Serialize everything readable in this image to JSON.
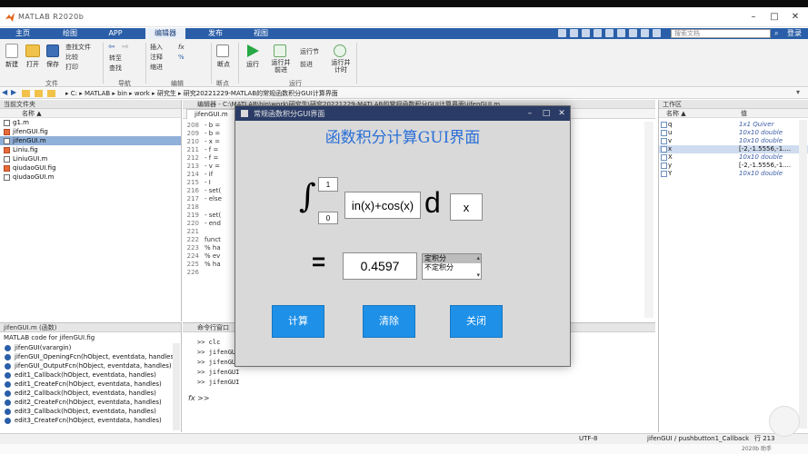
{
  "app": {
    "title": "MATLAB R2020b",
    "window_controls": [
      "–",
      "□",
      "✕"
    ]
  },
  "ribbon_tabs": {
    "items": [
      "主页",
      "绘图",
      "APP",
      "编辑器",
      "发布",
      "视图"
    ],
    "active_index": 3,
    "search_placeholder": "搜索文档",
    "login": "登录"
  },
  "ribbon": {
    "new_label": "新建",
    "open_label": "打开",
    "save_label": "保存",
    "find_files": "查找文件",
    "compare": "比较",
    "print": "打印",
    "file_group": "文件",
    "navigate_group": "导航",
    "goto": "转至",
    "find": "查找",
    "insert": "插入",
    "comment": "注释",
    "indent": "缩进",
    "edit_group": "编辑",
    "breakpoints": "断点",
    "run": "运行",
    "run_advance": "运行并前进",
    "run_section": "运行节",
    "advance": "前进",
    "run_time": "运行并计时",
    "run_group": "运行",
    "breakpoints_group": "断点"
  },
  "address": {
    "path": "▸ C: ▸ MATLAB ▸ bin ▸ work ▸ 研究生 ▸ 研究20221229-MATLAB的常规函数积分GUI计算界面"
  },
  "current_folder": {
    "title": "当前文件夹",
    "column": "名称 ▲",
    "files": [
      "g1.m",
      "jifenGUI.fig",
      "jifenGUI.m",
      "Liniu.fig",
      "LiniuGUI.m",
      "qiudaoGUI.fig",
      "qiudaoGUI.m"
    ],
    "selected_index": 2
  },
  "details": {
    "title": "jifenGUI.m (函数)",
    "header": "MATLAB code for jifenGUI.fig",
    "items": [
      "jifenGUI(varargin)",
      "jifenGUI_OpeningFcn(hObject, eventdata, handles)",
      "jifenGUI_OutputFcn(hObject, eventdata, handles)",
      "edit1_Callback(hObject, eventdata, handles)",
      "edit1_CreateFcn(hObject, eventdata, handles)",
      "edit2_Callback(hObject, eventdata, handles)",
      "edit2_CreateFcn(hObject, eventdata, handles)",
      "edit3_Callback(hObject, eventdata, handles)",
      "edit3_CreateFcn(hObject, eventdata, handles)"
    ]
  },
  "editor": {
    "tab_label": "编辑器 - C:\\MATLAB\\bin\\work\\研究生\\研究20221229-MATLAB的常规函数积分GUI计算界面\\jifenGUI.m",
    "file_tab": "jifenGUI.m",
    "lines": [
      {
        "n": "208",
        "t": "-  b ="
      },
      {
        "n": "209",
        "t": "-  b ="
      },
      {
        "n": "210",
        "t": "-  x ="
      },
      {
        "n": "211",
        "t": "-  f ="
      },
      {
        "n": "212",
        "t": "-  f ="
      },
      {
        "n": "213",
        "t": "-  v ="
      },
      {
        "n": "214",
        "t": "-  if"
      },
      {
        "n": "215",
        "t": "-    I"
      },
      {
        "n": "216",
        "t": "-    set("
      },
      {
        "n": "217",
        "t": "-  else"
      },
      {
        "n": "218",
        "t": ""
      },
      {
        "n": "219",
        "t": "-    set("
      },
      {
        "n": "220",
        "t": "-  end"
      },
      {
        "n": "221",
        "t": ""
      },
      {
        "n": "222",
        "t": "  funct"
      },
      {
        "n": "223",
        "t": "  % ha"
      },
      {
        "n": "224",
        "t": "  % ev"
      },
      {
        "n": "225",
        "t": "  % ha"
      },
      {
        "n": "226",
        "t": ""
      }
    ]
  },
  "command_window": {
    "title": "命令行窗口",
    "lines": [
      ">> clc",
      ">> jifenGUI",
      ">> jifenGUI",
      ">> jifenGUI",
      ">> jifenGUI"
    ],
    "prompt": "fx >>"
  },
  "workspace": {
    "title": "工作区",
    "col_name": "名称 ▲",
    "col_value": "值",
    "vars": [
      {
        "name": "q",
        "value": "1x1 Quiver",
        "style": "italic"
      },
      {
        "name": "u",
        "value": "10x10 double",
        "style": "italic"
      },
      {
        "name": "v",
        "value": "10x10 double",
        "style": "italic"
      },
      {
        "name": "x",
        "value": "[-2,-1.5556,-1....",
        "style": "plain"
      },
      {
        "name": "X",
        "value": "10x10 double",
        "style": "italic"
      },
      {
        "name": "y",
        "value": "[-2,-1.5556,-1....",
        "style": "plain"
      },
      {
        "name": "Y",
        "value": "10x10 double",
        "style": "italic"
      }
    ],
    "selected_index": 3
  },
  "status_bar": {
    "encoding": "UTF-8",
    "context": "jifenGUI / pushbutton1_Callback",
    "position": "行 213",
    "watermark": "2020b 助手"
  },
  "dialog": {
    "title": "常规函数积分GUI界面",
    "heading": "函数积分计算GUI界面",
    "upper_limit": "1",
    "lower_limit": "0",
    "function": "in(x)+cos(x)",
    "d_symbol": "d",
    "variable": "x",
    "equals": "=",
    "result": "0.4597",
    "integral_symbol": "∫",
    "options": [
      "定积分",
      "不定积分"
    ],
    "selected_option": 0,
    "btn_compute": "计算",
    "btn_clear": "清除",
    "btn_close": "关闭",
    "controls": [
      "–",
      "□",
      "✕"
    ]
  },
  "colors": {
    "ribbon_blue": "#2a5ea8",
    "dialog_bar": "#2a3c66",
    "button_blue": "#1e90e8",
    "heading_blue": "#2a6fd6",
    "selection": "#8fb0d8"
  }
}
